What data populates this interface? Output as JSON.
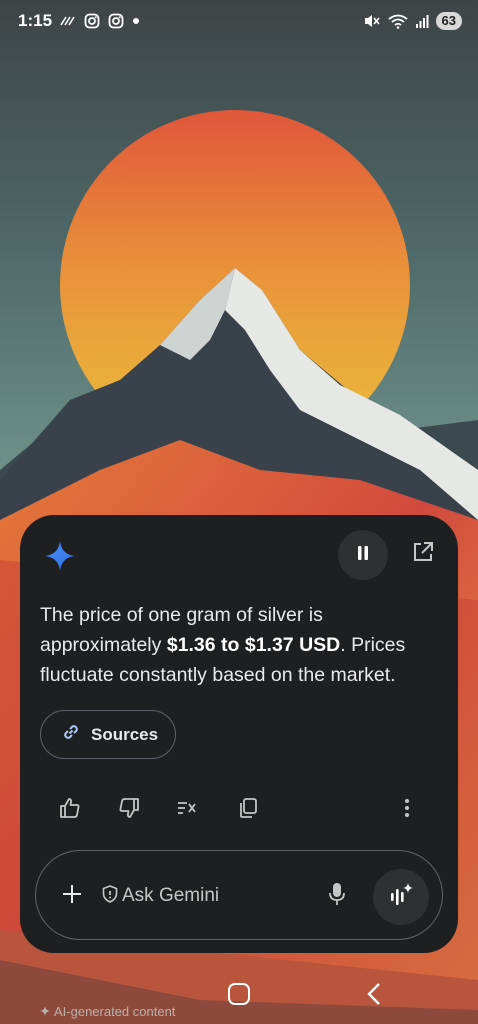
{
  "status_bar": {
    "time": "1:15",
    "battery": "63",
    "icons": [
      "tiktok-icon",
      "instagram-icon",
      "instagram-icon",
      "dot-icon",
      "mute-icon",
      "wifi-icon",
      "signal-icon"
    ]
  },
  "gemini": {
    "logo": "gemini-sparkle-icon",
    "answer": {
      "before": "The price of one gram of silver is approximately ",
      "highlight": "$1.36 to $1.37 USD",
      "after": ". Prices fluctuate constantly based on the market."
    },
    "sources_label": "Sources",
    "actions": [
      "thumbs-up-icon",
      "thumbs-down-icon",
      "double-check-icon",
      "copy-icon",
      "more-vert-icon"
    ],
    "input": {
      "placeholder": "Ask Gemini"
    }
  },
  "footer": {
    "ai_note": "AI-generated content"
  },
  "colors": {
    "card_bg": "#1e1f20",
    "gemini_blue": "#4b8df8",
    "sky_top": "#3f4547",
    "sun": "#e8b23a"
  }
}
